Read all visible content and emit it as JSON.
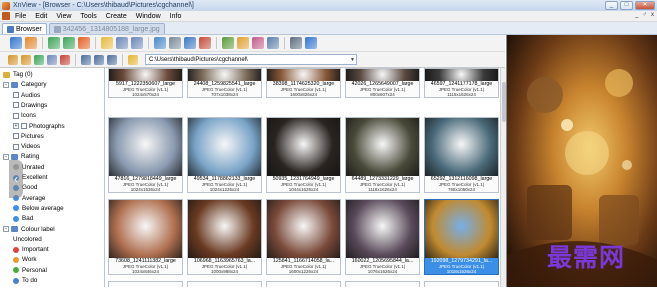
{
  "window": {
    "title": "XnView - [Browser - C:\\Users\\thibaud\\Pictures\\cgchannel\\]",
    "min_label": "_",
    "max_label": "□",
    "close_label": "✕"
  },
  "menu": [
    "File",
    "Edit",
    "View",
    "Tools",
    "Create",
    "Window",
    "Info"
  ],
  "menu_right": [
    "_",
    "♂",
    "x"
  ],
  "tabs": [
    {
      "label": "Browser",
      "active": true
    },
    {
      "label": "342456_1314805188_large.jpg",
      "active": false
    }
  ],
  "toolbar1_icons": [
    {
      "name": "browse-icon",
      "color": "#2f74d0"
    },
    {
      "name": "view-icon",
      "color": "#e3872b"
    },
    {
      "name": "sep"
    },
    {
      "name": "refresh-icon",
      "color": "#3aa457"
    },
    {
      "name": "refresh2-icon",
      "color": "#3aa457"
    },
    {
      "name": "web-icon",
      "color": "#e35f24"
    },
    {
      "name": "sep"
    },
    {
      "name": "folder-icon",
      "color": "#e7b93b"
    },
    {
      "name": "copy-icon",
      "color": "#6a86b8"
    },
    {
      "name": "move-icon",
      "color": "#6a86b8"
    },
    {
      "name": "sep"
    },
    {
      "name": "find-icon",
      "color": "#4a88c8"
    },
    {
      "name": "print-icon",
      "color": "#7a8a9a"
    },
    {
      "name": "scan-icon",
      "color": "#3978c2"
    },
    {
      "name": "capture-icon",
      "color": "#c44b3a"
    },
    {
      "name": "sep"
    },
    {
      "name": "slideshow-icon",
      "color": "#5a9a3a"
    },
    {
      "name": "convert-icon",
      "color": "#e0a030"
    },
    {
      "name": "rename-icon",
      "color": "#c35a8a"
    },
    {
      "name": "grid-icon",
      "color": "#5b7fa8"
    },
    {
      "name": "sep"
    },
    {
      "name": "settings-icon",
      "color": "#5d6d80"
    },
    {
      "name": "info-icon",
      "color": "#2f74d0"
    }
  ],
  "toolbar2_icons": [
    {
      "name": "back-icon",
      "color": "#d2952a"
    },
    {
      "name": "forward-icon",
      "color": "#d2952a"
    },
    {
      "name": "up-icon",
      "color": "#3aa457"
    },
    {
      "name": "select-all-icon",
      "color": "#6a86b8"
    },
    {
      "name": "delete-icon",
      "color": "#c4402e"
    },
    {
      "name": "sep"
    },
    {
      "name": "view-mode-icon",
      "color": "#4a6d9a"
    },
    {
      "name": "sort-icon",
      "color": "#4a6d9a"
    },
    {
      "name": "filter-icon",
      "color": "#4a6d9a"
    },
    {
      "name": "sep"
    },
    {
      "name": "favorite-icon",
      "color": "#e5b32a"
    }
  ],
  "path": "C:\\Users\\thibaud\\Pictures\\cgchannel\\",
  "tree": [
    {
      "label": "Tag (0)",
      "indent": 0,
      "exp": "",
      "icon": "#d9b23a"
    },
    {
      "label": "Category",
      "indent": 0,
      "exp": "−",
      "icon": "#5d86c4"
    },
    {
      "label": "Audios",
      "indent": 1,
      "chk": true
    },
    {
      "label": "Drawings",
      "indent": 1,
      "chk": true
    },
    {
      "label": "Icons",
      "indent": 1,
      "chk": true
    },
    {
      "label": "Photographs",
      "indent": 1,
      "chk": true,
      "exp": "+"
    },
    {
      "label": "Pictures",
      "indent": 1,
      "chk": true
    },
    {
      "label": "Videos",
      "indent": 1,
      "chk": true
    },
    {
      "label": "Rating",
      "indent": 0,
      "exp": "−",
      "icon": "#5d86c4"
    },
    {
      "label": "Unrated",
      "indent": 1,
      "swatch": "#b0b0b0"
    },
    {
      "label": "Excellent",
      "indent": 1,
      "swatch": "#3c8fe6"
    },
    {
      "label": "Good",
      "indent": 1,
      "swatch": "#3c8fe6"
    },
    {
      "label": "Average",
      "indent": 1,
      "swatch": "#3c8fe6"
    },
    {
      "label": "Below average",
      "indent": 1,
      "swatch": "#3c8fe6"
    },
    {
      "label": "Bad",
      "indent": 1,
      "swatch": "#3c8fe6"
    },
    {
      "label": "Colour label",
      "indent": 0,
      "exp": "−",
      "icon": "#5d86c4"
    },
    {
      "label": "Uncolored",
      "indent": 1
    },
    {
      "label": "Important",
      "indent": 1,
      "swatch": "#e04040"
    },
    {
      "label": "Work",
      "indent": 1,
      "swatch": "#e89a30"
    },
    {
      "label": "Personal",
      "indent": 1,
      "swatch": "#4aaa40"
    },
    {
      "label": "To do",
      "indent": 1,
      "swatch": "#4a7fd0"
    }
  ],
  "thumbnails": [
    [
      {
        "name": "5917_1222350607_large",
        "meta1": "JPEG TrueColor (v1.1)",
        "meta2": "1024x570x24",
        "color": "#6a4a3a"
      },
      {
        "name": "24408_1259825541_large",
        "meta1": "JPEG TrueColor (v1.1)",
        "meta2": "707x1038x24",
        "color": "#7a6a58"
      },
      {
        "name": "38398_1174625320_large",
        "meta1": "JPEG TrueColor (v1.1)",
        "meta2": "1600x826x24",
        "color": "#8a5a3a"
      },
      {
        "name": "42026_1265649007_large",
        "meta1": "JPEG TrueColor (v1.1)",
        "meta2": "800x607x24",
        "color": "#5a4a42"
      },
      {
        "name": "46597_1241177178_large",
        "meta1": "JPEG TrueColor (v1.1)",
        "meta2": "1115x1626x24",
        "color": "#3a3a3a"
      }
    ],
    [
      {
        "name": "47816_1279818449_large",
        "meta1": "JPEG TrueColor (v1.1)",
        "meta2": "1024x1536x24",
        "color": "#8a9ab0"
      },
      {
        "name": "49534_1178862133_large",
        "meta1": "JPEG TrueColor (v1.1)",
        "meta2": "1024x1226x24",
        "color": "#7aa4c8"
      },
      {
        "name": "50935_1231764949_large",
        "meta1": "JPEG TrueColor (v1.1)",
        "meta2": "1044x1626x24",
        "color": "#2a2420"
      },
      {
        "name": "64489_1273331229_large",
        "meta1": "JPEG TrueColor (v1.1)",
        "meta2": "1118x1626x24",
        "color": "#4a4a3a"
      },
      {
        "name": "65292_1312116098_large",
        "meta1": "JPEG TrueColor (v1.1)",
        "meta2": "768x1050x24",
        "color": "#4a6a7a"
      }
    ],
    [
      {
        "name": "73608_1241111382_large",
        "meta1": "JPEG TrueColor (v1.1)",
        "meta2": "1024x846x24",
        "color": "#b07050"
      },
      {
        "name": "106968_1163965763_la...",
        "meta1": "JPEG TrueColor (v1.1)",
        "meta2": "1000x988x24",
        "color": "#6a3a22"
      },
      {
        "name": "125841_1166714058_la...",
        "meta1": "JPEG TrueColor (v1.1)",
        "meta2": "1600x1226x24",
        "color": "#7a4a3a"
      },
      {
        "name": "160022_1205695844_la...",
        "meta1": "JPEG TrueColor (v1.1)",
        "meta2": "1076x1626x24",
        "color": "#5a4a5a"
      },
      {
        "name": "192098_1279734291_la...",
        "meta1": "JPEG TrueColor (v1.1)",
        "meta2": "1018x1626x24",
        "color": "#c08a30",
        "selected": true
      }
    ]
  ],
  "watermark": "最需网",
  "nav_arrow": "‹"
}
